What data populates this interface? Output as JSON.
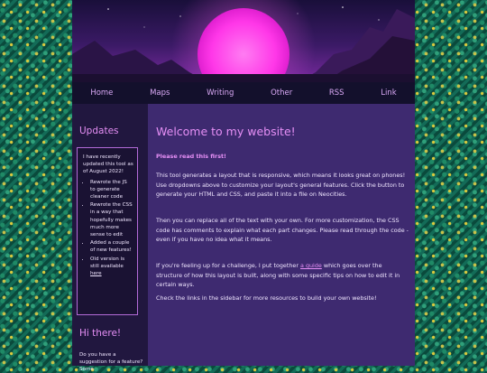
{
  "nav": {
    "items": [
      "Home",
      "Maps",
      "Writing",
      "Other",
      "RSS",
      "Link"
    ]
  },
  "sidebar": {
    "updates_title": "Updates",
    "intro": "I have recently updated this tool as of August 2022!",
    "items": [
      "Rewrote the JS to generate cleaner code",
      "Rewrote the CSS in a way that hopefully makes much more sense to edit",
      "Added a couple of new features!"
    ],
    "last_item_prefix": "Old version is still available ",
    "last_item_link": "here",
    "hi_title": "Hi there!",
    "hi_text": "Do you have a suggestion for a feature? Some"
  },
  "main": {
    "title": "Welcome to my website!",
    "notice": "Please read this first!",
    "para1": "This tool generates a layout that is responsive, which means it looks great on phones! Use dropdowns above to customize your layout's general features. Click the button to generate your HTML and CSS, and paste it into a file on Neocities.",
    "para2": "Then you can replace all of the text with your own. For more customization, the CSS code has comments to explain what each part changes. Please read through the code - even if you have no idea what it means.",
    "para3_before": "If you're feeling up for a challenge, I put together ",
    "para3_link": "a guide",
    "para3_after": " which goes over the structure of how this layout is built, along with some specific tips on how to edit it in certain ways.",
    "para4": "Check the links in the sidebar for more resources to build your own website!"
  },
  "colors": {
    "accent": "#e58ff5",
    "main_bg": "#3e2a70",
    "sidebar_bg": "#21173f",
    "nav_bg": "#13102c",
    "page_bg": "#0f5a4a"
  }
}
